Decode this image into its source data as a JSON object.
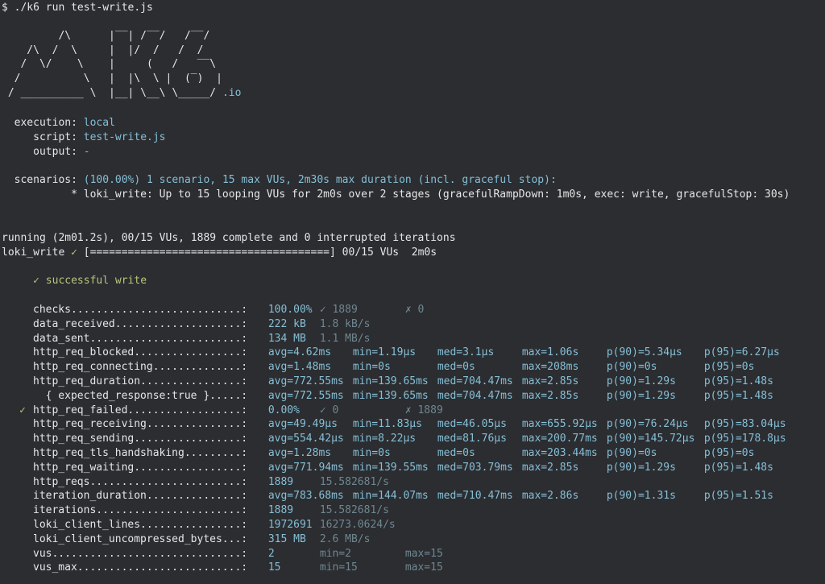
{
  "command": "$ ./k6 run test-write.js",
  "logo": [
    "         /\\      |‾‾| /‾‾/   /‾‾/",
    "    /\\  /  \\     |  |/  /   /  /",
    "   /  \\/    \\    |     (   /   ‾‾\\",
    "  /          \\   |  |\\  \\ |  (‾)  |",
    " / __________ \\  |__| \\__\\ \\_____/"
  ],
  "logo_suffix": ".io",
  "execution": {
    "label": "execution:",
    "value": "local"
  },
  "script": {
    "label": "script:",
    "value": "test-write.js"
  },
  "output": {
    "label": "output:",
    "value": "-"
  },
  "scenarios": {
    "label": "scenarios:",
    "value": "(100.00%) 1 scenario, 15 max VUs, 2m30s max duration (incl. graceful stop):",
    "detail": "* loki_write: Up to 15 looping VUs for 2m0s over 2 stages (gracefulRampDown: 1m0s, exec: write, gracefulStop: 30s)"
  },
  "running": "running (2m01.2s), 00/15 VUs, 1889 complete and 0 interrupted iterations",
  "progress": {
    "name": "loki_write",
    "check": "✓",
    "bar": "[======================================]",
    "status": "00/15 VUs  2m0s",
    "fraction": 1.0
  },
  "check_line": "✓ successful write",
  "metrics": [
    {
      "name": "checks...........................:",
      "v1": "100.00%",
      "v1c": "w",
      "v2": "✓ 1889",
      "v3": "✗ 0"
    },
    {
      "name": "data_received....................:",
      "v1": "222 kB",
      "v2": "1.8 kB/s"
    },
    {
      "name": "data_sent........................:",
      "v1": "134 MB",
      "v2": "1.1 MB/s"
    },
    {
      "name": "http_req_blocked.................:",
      "cols": [
        "avg=4.62ms",
        "min=1.19µs",
        "med=3.1µs",
        "max=1.06s",
        "p(90)=5.34µs",
        "p(95)=6.27µs"
      ]
    },
    {
      "name": "http_req_connecting..............:",
      "cols": [
        "avg=1.48ms",
        "min=0s",
        "med=0s",
        "max=208ms",
        "p(90)=0s",
        "p(95)=0s"
      ]
    },
    {
      "name": "http_req_duration................:",
      "cols": [
        "avg=772.55ms",
        "min=139.65ms",
        "med=704.47ms",
        "max=2.85s",
        "p(90)=1.29s",
        "p(95)=1.48s"
      ]
    },
    {
      "name": "  { expected_response:true }.....:",
      "cols": [
        "avg=772.55ms",
        "min=139.65ms",
        "med=704.47ms",
        "max=2.85s",
        "p(90)=1.29s",
        "p(95)=1.48s"
      ]
    },
    {
      "name": "http_req_failed..................:",
      "mark": "✓",
      "v1": "0.00%",
      "v1c": "w",
      "v2": "✓ 0",
      "v3": "✗ 1889"
    },
    {
      "name": "http_req_receiving...............:",
      "cols": [
        "avg=49.49µs",
        "min=11.83µs",
        "med=46.05µs",
        "max=655.92µs",
        "p(90)=76.24µs",
        "p(95)=83.04µs"
      ]
    },
    {
      "name": "http_req_sending.................:",
      "cols": [
        "avg=554.42µs",
        "min=8.22µs",
        "med=81.76µs",
        "max=200.77ms",
        "p(90)=145.72µs",
        "p(95)=178.8µs"
      ]
    },
    {
      "name": "http_req_tls_handshaking.........:",
      "cols": [
        "avg=1.28ms",
        "min=0s",
        "med=0s",
        "max=203.44ms",
        "p(90)=0s",
        "p(95)=0s"
      ]
    },
    {
      "name": "http_req_waiting.................:",
      "cols": [
        "avg=771.94ms",
        "min=139.55ms",
        "med=703.79ms",
        "max=2.85s",
        "p(90)=1.29s",
        "p(95)=1.48s"
      ]
    },
    {
      "name": "http_reqs........................:",
      "v1": "1889",
      "v2": "15.582681/s"
    },
    {
      "name": "iteration_duration...............:",
      "cols": [
        "avg=783.68ms",
        "min=144.07ms",
        "med=710.47ms",
        "max=2.86s",
        "p(90)=1.31s",
        "p(95)=1.51s"
      ]
    },
    {
      "name": "iterations.......................:",
      "v1": "1889",
      "v2": "15.582681/s"
    },
    {
      "name": "loki_client_lines................:",
      "v1": "1972691",
      "v2": "16273.0624/s"
    },
    {
      "name": "loki_client_uncompressed_bytes...:",
      "v1": "315 MB",
      "v2": "2.6 MB/s"
    },
    {
      "name": "vus..............................:",
      "v1": "2",
      "v2": "min=2",
      "v3": "max=15"
    },
    {
      "name": "vus_max..........................:",
      "v1": "15",
      "v2": "min=15",
      "v3": "max=15"
    }
  ]
}
